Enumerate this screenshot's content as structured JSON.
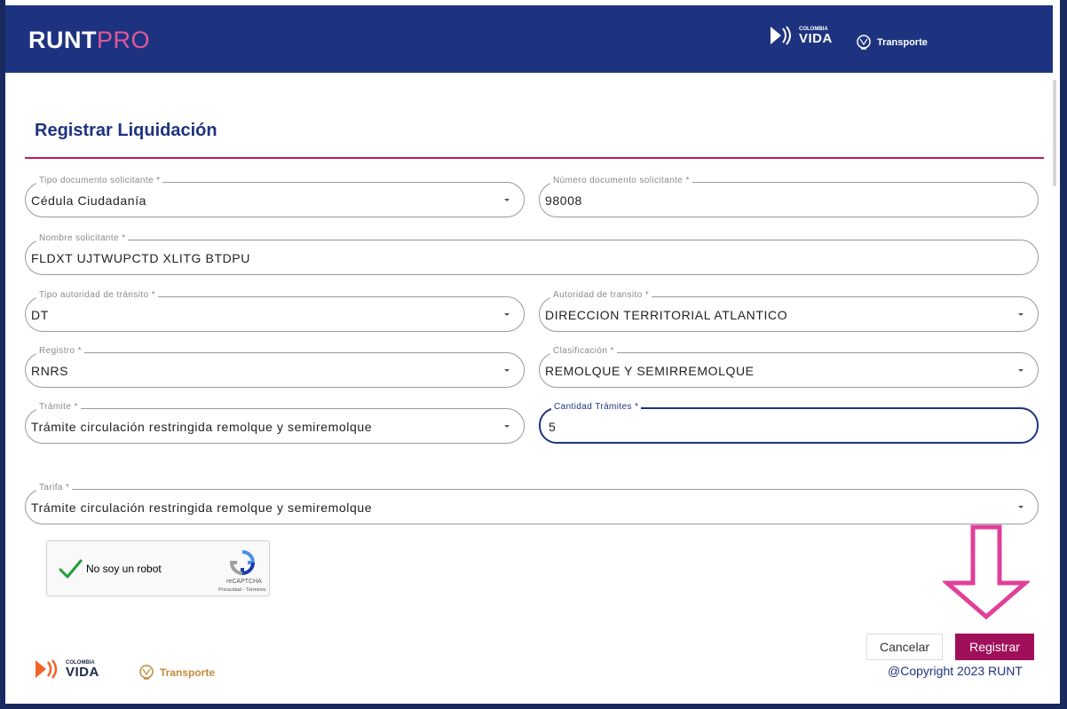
{
  "header": {
    "logo_bold": "RUNT",
    "logo_light": "PRO",
    "vida_small": "COLOMBIA",
    "vida_big": "VIDA",
    "transporte": "Transporte"
  },
  "page": {
    "title": "Registrar Liquidación"
  },
  "form": {
    "tipo_documento": {
      "label": "Tipo documento solicitante *",
      "value": "Cédula Ciudadanía"
    },
    "numero_documento": {
      "label": "Número documento solicitante *",
      "value": "98008"
    },
    "nombre": {
      "label": "Nombre solicitante *",
      "value": "FLDXT UJTWUPCTD XLITG BTDPU"
    },
    "tipo_autoridad": {
      "label": "Tipo autoridad de tránsito *",
      "value": "DT"
    },
    "autoridad": {
      "label": "Autoridad de transito *",
      "value": "DIRECCION TERRITORIAL ATLANTICO"
    },
    "registro": {
      "label": "Registro *",
      "value": "RNRS"
    },
    "clasificacion": {
      "label": "Clasificación *",
      "value": "REMOLQUE Y SEMIRREMOLQUE"
    },
    "tramite": {
      "label": "Trámite *",
      "value": "Trámite circulación restringida remolque y semiremolque"
    },
    "cantidad": {
      "label": "Cantidad Trámites *",
      "value": "5"
    },
    "tarifa": {
      "label": "Tarifa *",
      "value": "Trámite circulación restringida remolque y semiremolque"
    }
  },
  "recaptcha": {
    "label": "No soy un robot",
    "brand": "reCAPTCHA",
    "links": "Privacidad - Términos"
  },
  "buttons": {
    "cancel": "Cancelar",
    "register": "Registrar"
  },
  "footer": {
    "vida_small": "COLOMBIA",
    "vida_big": "VIDA",
    "transporte": "Transporte",
    "copyright": "@Copyright 2023 RUNT"
  },
  "colors": {
    "header_bg": "#1e3380",
    "accent_pink": "#c2185b",
    "register_button": "#a0105a",
    "arrow": "#e0409a"
  },
  "icons": [
    "chevron-down-icon",
    "checkmark-icon",
    "recaptcha-logo-icon",
    "colombia-vida-logo",
    "transporte-shield-icon",
    "down-arrow-annotation"
  ]
}
